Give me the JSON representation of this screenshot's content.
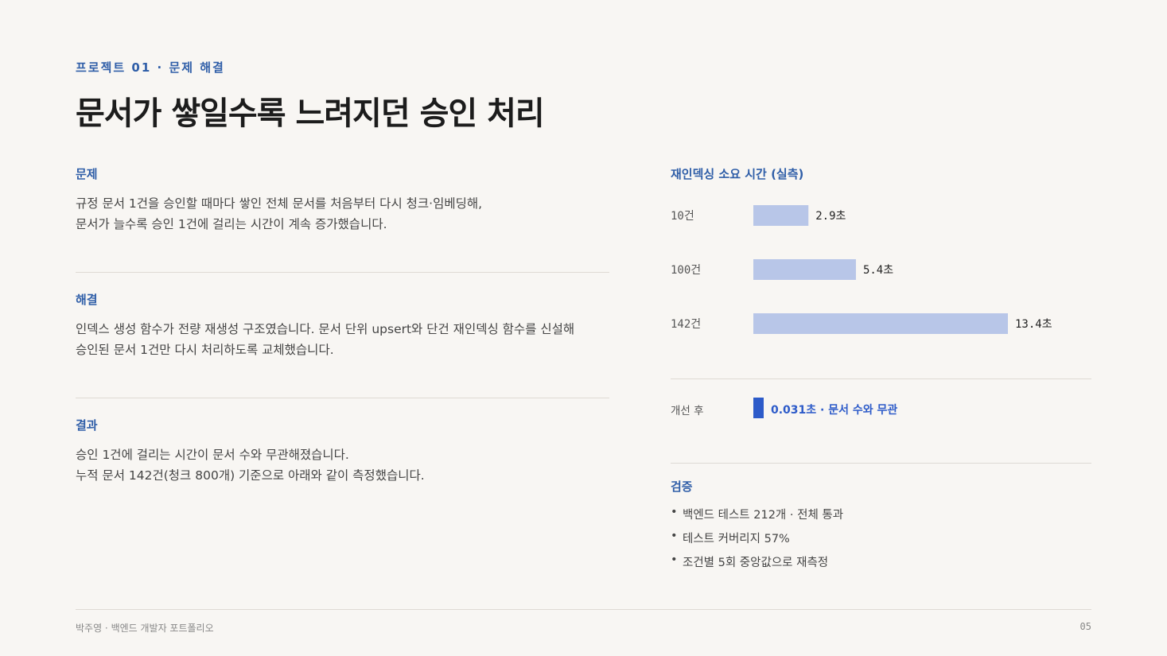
{
  "header": {
    "eyebrow": "프로젝트 01 · 문제 해결",
    "title": "문서가 쌓일수록 느려지던 승인 처리"
  },
  "sections": [
    {
      "heading": "문제",
      "lines": [
        "규정 문서 1건을 승인할 때마다 쌓인 전체 문서를 처음부터 다시 청크·임베딩해,",
        "문서가 늘수록 승인 1건에 걸리는 시간이 계속 증가했습니다."
      ]
    },
    {
      "heading": "해결",
      "lines": [
        "인덱스 생성 함수가 전량 재생성 구조였습니다. 문서 단위 upsert와 단건 재인덱싱 함수를 신설해",
        "승인된 문서 1건만 다시 처리하도록 교체했습니다."
      ]
    },
    {
      "heading": "결과",
      "lines": [
        "승인 1건에 걸리는 시간이 문서 수와 무관해졌습니다.",
        "누적 문서 142건(청크 800개) 기준으로 아래와 같이 측정했습니다."
      ]
    }
  ],
  "chart_data": {
    "type": "bar",
    "orientation": "horizontal",
    "title": "재인덱싱 소요 시간 (실측)",
    "categories": [
      "10건",
      "100건",
      "142건"
    ],
    "values": [
      2.9,
      5.4,
      13.4
    ],
    "value_labels": [
      "2.9초",
      "5.4초",
      "13.4초"
    ],
    "unit": "초",
    "bar_color": "#b8c6e8",
    "xlim": [
      0,
      13.4
    ],
    "grid": false
  },
  "after": {
    "label": "개선 후",
    "value": 0.031,
    "text": "0.031초 · 문서 수와 무관",
    "color": "#2d5bc9"
  },
  "verification": {
    "heading": "검증",
    "items": [
      "백엔드 테스트 212개 · 전체 통과",
      "테스트 커버리지 57%",
      "조건별 5회 중앙값으로 재측정"
    ]
  },
  "footer": {
    "left": "박주영 · 백엔드 개발자 포트폴리오",
    "page": "05"
  },
  "colors": {
    "accent": "#2f5ea8",
    "background": "#f8f6f3"
  }
}
